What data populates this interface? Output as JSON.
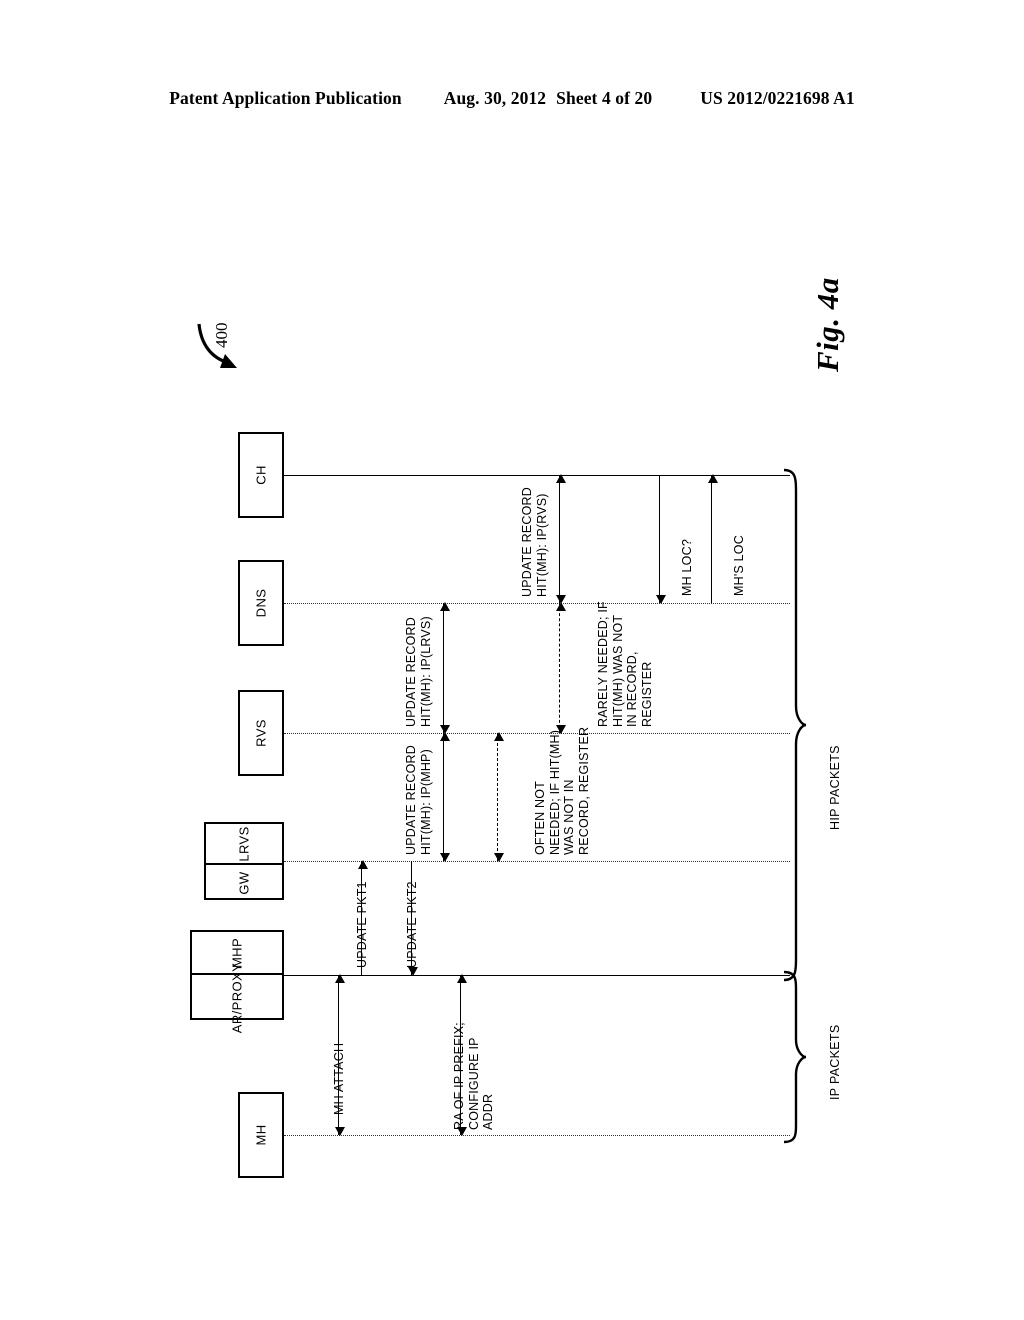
{
  "header": {
    "publication": "Patent Application Publication",
    "date": "Aug. 30, 2012",
    "sheet": "Sheet 4 of 20",
    "pub_number": "US 2012/0221698 A1"
  },
  "figure": {
    "title": "Fig. 4a",
    "reference_numeral": "400",
    "type": "sequence-diagram",
    "orientation": "rotated-90-ccw",
    "lifelines": [
      {
        "id": "mh",
        "labels": [
          "MH"
        ]
      },
      {
        "id": "mhp",
        "labels": [
          "MHP",
          "AR/PROXY"
        ]
      },
      {
        "id": "lrvs",
        "labels": [
          "LRVS",
          "GW"
        ]
      },
      {
        "id": "rvs",
        "labels": [
          "RVS"
        ]
      },
      {
        "id": "dns",
        "labels": [
          "DNS"
        ]
      },
      {
        "id": "ch",
        "labels": [
          "CH"
        ]
      }
    ],
    "messages": [
      {
        "id": "mh-attach",
        "label": "MH ATTACH",
        "style": "solid",
        "direction": "up"
      },
      {
        "id": "ra-prefix",
        "label": "RA OF IP PREFIX;\nCONFIGURE IP\nADDR",
        "style": "solid",
        "direction": "down"
      },
      {
        "id": "update-pkt1",
        "label": "UPDATE PKT1",
        "style": "solid",
        "direction": "up"
      },
      {
        "id": "update-pkt2",
        "label": "UPDATE PKT2",
        "style": "solid",
        "direction": "down"
      },
      {
        "id": "update-rec-mhp",
        "label": "UPDATE RECORD\nHIT(MH): IP(MHP)",
        "style": "solid",
        "direction": "both"
      },
      {
        "id": "often-not",
        "label": "OFTEN NOT\nNEEDED; IF HIT(MH)\nWAS NOT IN\nRECORD, REGISTER",
        "style": "dashed",
        "direction": "both"
      },
      {
        "id": "update-rec-lrvs",
        "label": "UPDATE RECORD\nHIT(MH): IP(LRVS)",
        "style": "solid",
        "direction": "both"
      },
      {
        "id": "rarely-needed",
        "label": "RARELY NEEDED; IF\nHIT(MH) WAS NOT\nIN RECORD,\nREGISTER",
        "style": "dashed",
        "direction": "both"
      },
      {
        "id": "update-rec-rvs",
        "label": "UPDATE RECORD\nHIT(MH): IP(RVS)",
        "style": "solid",
        "direction": "both"
      },
      {
        "id": "mh-loc-query",
        "label": "MH LOC?",
        "style": "solid",
        "direction": "down"
      },
      {
        "id": "mh-loc-reply",
        "label": "MH'S LOC",
        "style": "solid",
        "direction": "up"
      }
    ],
    "groups": [
      {
        "id": "hip-packets",
        "label": "HIP PACKETS"
      },
      {
        "id": "ip-packets",
        "label": "IP PACKETS"
      }
    ]
  }
}
